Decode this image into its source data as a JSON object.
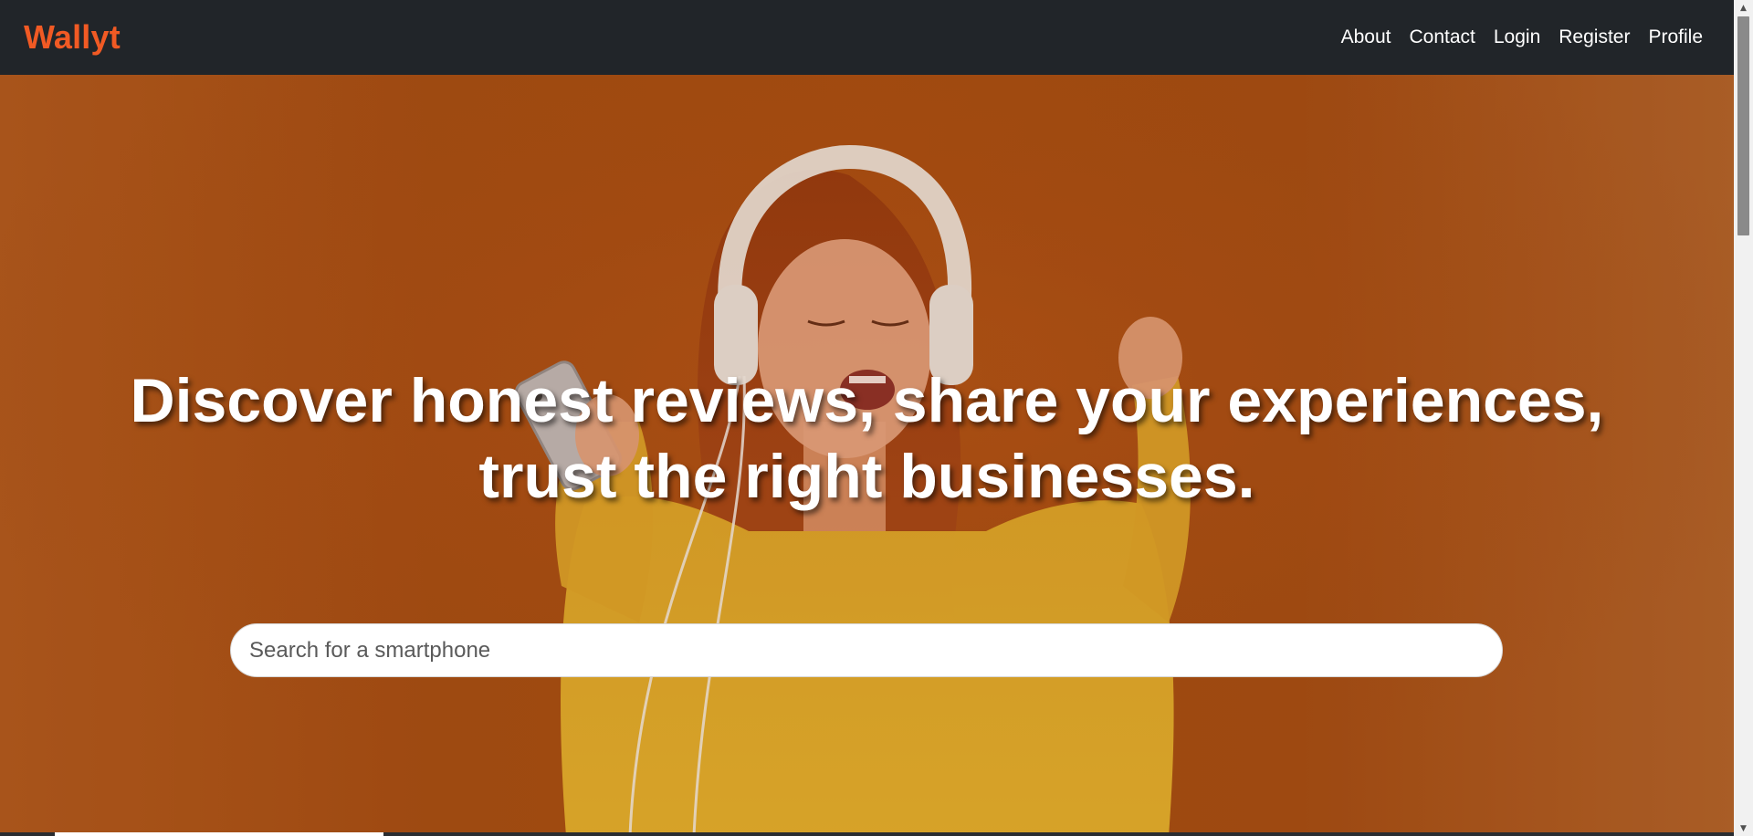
{
  "navbar": {
    "brand": "Wallyt",
    "links": [
      {
        "label": "About"
      },
      {
        "label": "Contact"
      },
      {
        "label": "Login"
      },
      {
        "label": "Register"
      },
      {
        "label": "Profile"
      }
    ]
  },
  "hero": {
    "title_line1": "Discover honest reviews, share your experiences,",
    "title_line2": "trust the right businesses.",
    "search": {
      "value": "",
      "placeholder": "Search for a smartphone"
    }
  },
  "colors": {
    "brand": "#f15a24",
    "navbar_bg": "#212529",
    "hero_bg": "#a04a12",
    "sweater": "#e8c22a"
  },
  "icons": {
    "scroll_up": "scroll-up-arrow-icon",
    "scroll_down": "scroll-down-arrow-icon"
  }
}
